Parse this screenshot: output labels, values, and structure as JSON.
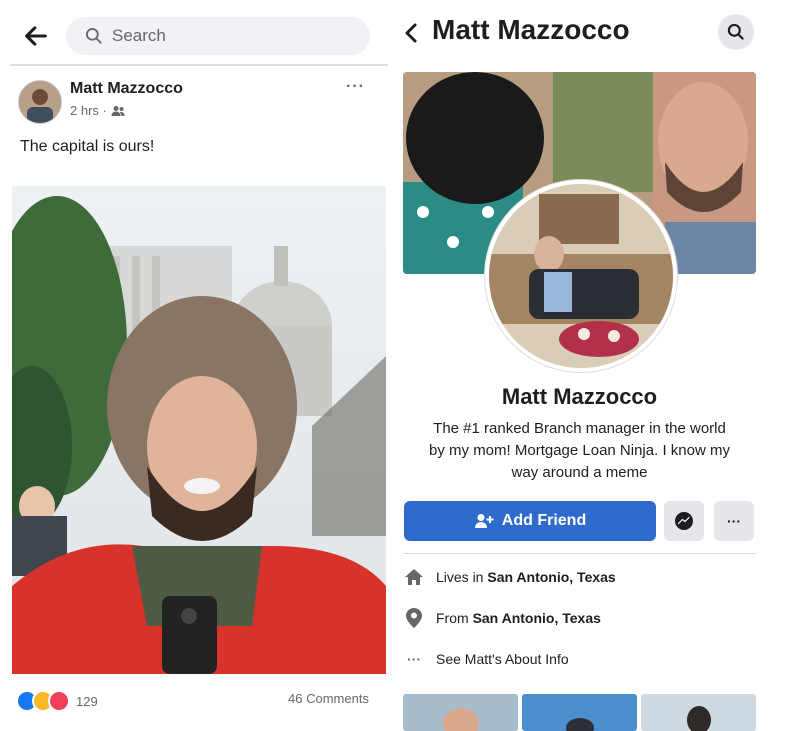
{
  "left": {
    "search": {
      "placeholder": "Search"
    },
    "post": {
      "author": "Matt Mazzocco",
      "time": "2 hrs ·",
      "text": "The capital is ours!",
      "more": "···",
      "reaction_count": "129",
      "comments": "46 Comments"
    }
  },
  "right": {
    "title": "Matt Mazzocco",
    "name": "Matt Mazzocco",
    "bio_lines": [
      "The #1 ranked Branch manager in the world",
      "by my mom! Mortgage Loan Ninja. I know my",
      "way around a meme"
    ],
    "add_friend": "Add Friend",
    "more": "···",
    "info": {
      "lives_prefix": "Lives in",
      "lives_place": "San Antonio, Texas",
      "from_prefix": "From",
      "from_place": "San Antonio, Texas",
      "about": "See Matt's About Info"
    }
  },
  "colors": {
    "accent": "#2f6bcb",
    "like_blue": "#1877f2",
    "haha_yellow": "#f7b928",
    "love_red": "#f33e58"
  }
}
